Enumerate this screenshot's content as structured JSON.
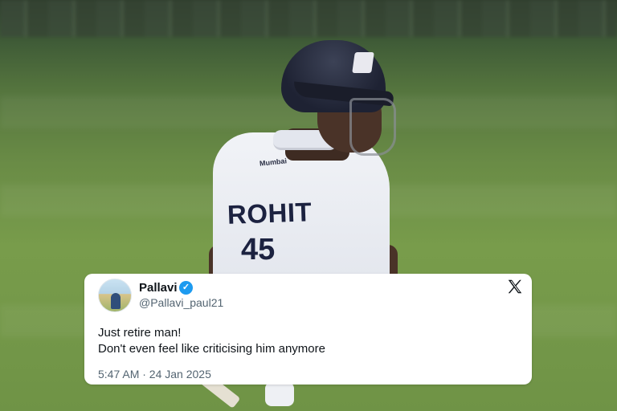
{
  "photo": {
    "jersey_name": "ROHIT",
    "jersey_number": "45",
    "sponsor": "Mumbai"
  },
  "tweet": {
    "display_name": "Pallavi",
    "verified_icon": "verified-badge-icon",
    "handle": "@Pallavi_paul21",
    "text_line1": "Just retire man!",
    "text_line2": "Don't even feel like criticising him anymore",
    "timestamp": "5:47 AM · 24 Jan 2025",
    "platform_icon": "x-logo-icon",
    "colors": {
      "verified": "#1d9bf0",
      "text": "#0f1419",
      "secondary": "#536471"
    }
  }
}
